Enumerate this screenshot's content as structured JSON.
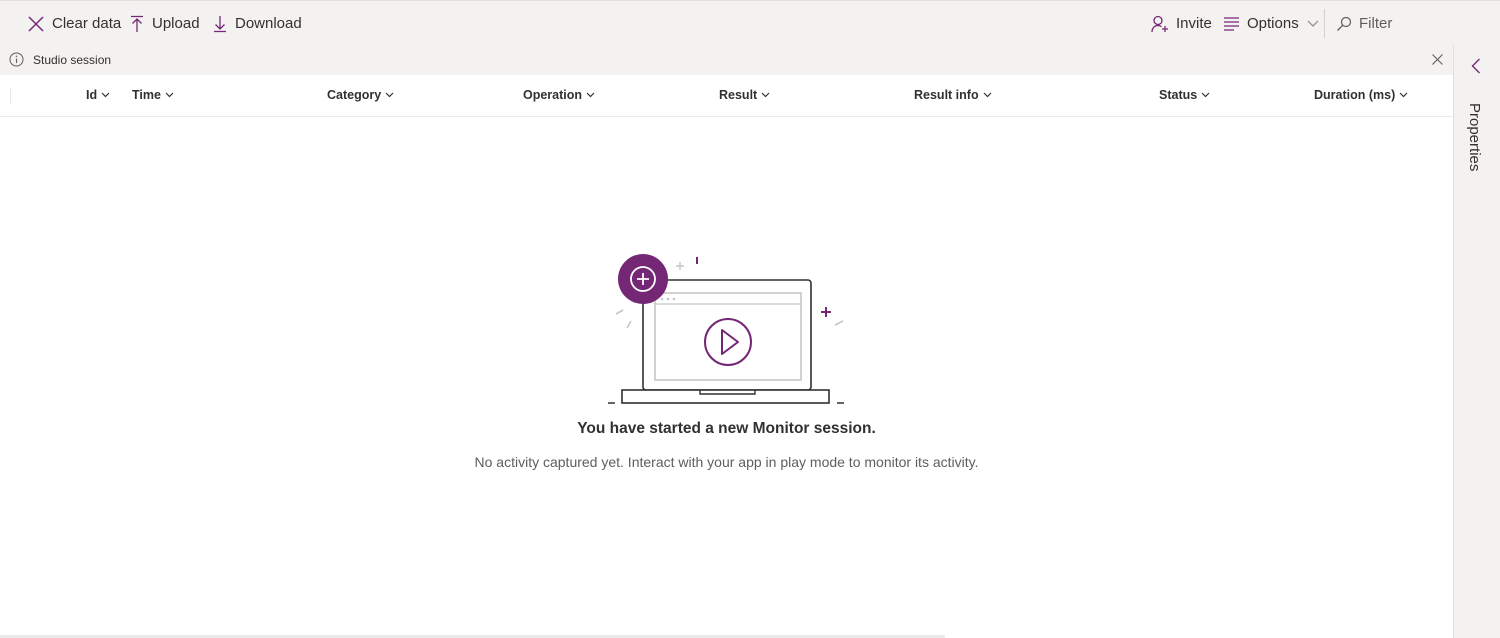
{
  "toolbar": {
    "clear_label": "Clear data",
    "upload_label": "Upload",
    "download_label": "Download",
    "invite_label": "Invite",
    "options_label": "Options",
    "filter_label": "Filter"
  },
  "notice": {
    "text": "Studio session"
  },
  "grid": {
    "columns": [
      {
        "label": "Id"
      },
      {
        "label": "Time"
      },
      {
        "label": "Category"
      },
      {
        "label": "Operation"
      },
      {
        "label": "Result"
      },
      {
        "label": "Result info"
      },
      {
        "label": "Status"
      },
      {
        "label": "Duration (ms)"
      }
    ]
  },
  "empty_state": {
    "title": "You have started a new Monitor session.",
    "subtitle": "No activity captured yet. Interact with your app in play mode to monitor its activity."
  },
  "side_panel": {
    "label": "Properties"
  },
  "colors": {
    "accent": "#742774",
    "toolbar_bg": "#f3f2f1",
    "text": "#323130"
  },
  "icons": {
    "clear": "close-icon",
    "upload": "upload-arrow-icon",
    "download": "download-arrow-icon",
    "invite": "person-add-icon",
    "options": "options-lines-icon",
    "filter": "filter-search-icon",
    "notice": "info-icon",
    "panel": "chevron-left-icon"
  }
}
